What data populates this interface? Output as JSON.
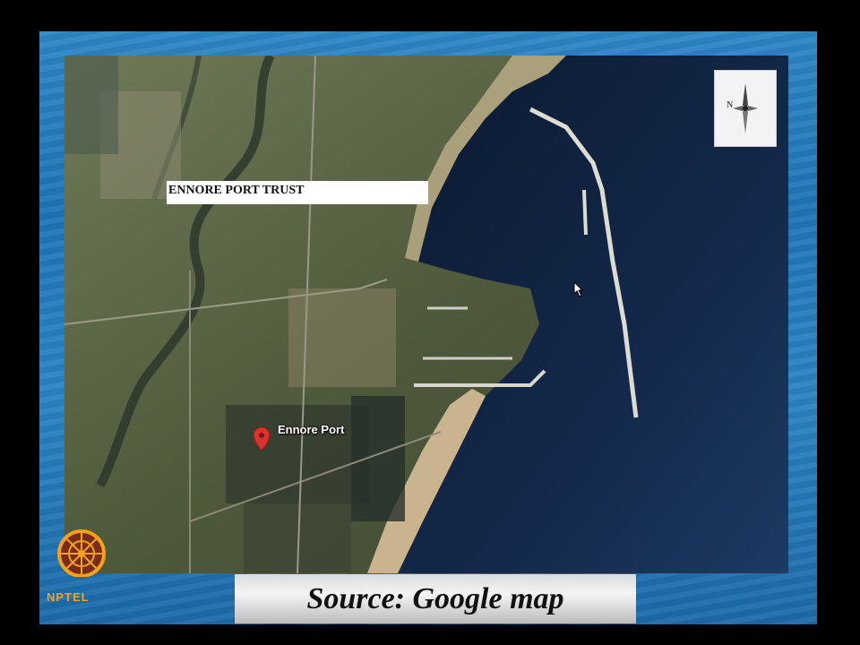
{
  "map": {
    "region_label": "ENNORE PORT TRUST",
    "pin_label": "Ennore Port",
    "compass_letter": "N"
  },
  "footer": {
    "source_text": "Source: Google map",
    "brand": "NPTEL"
  },
  "icons": {
    "pin": "map-pin-icon",
    "compass": "compass-icon",
    "cursor": "cursor-icon",
    "logo": "nptel-logo-icon"
  },
  "colors": {
    "sea": "#0d1c34",
    "land": "#5e6a48",
    "beach": "#c9b48f",
    "frame_blue": "#2277b8",
    "pin_red": "#d8342a",
    "brand_orange": "#f4a21a"
  }
}
